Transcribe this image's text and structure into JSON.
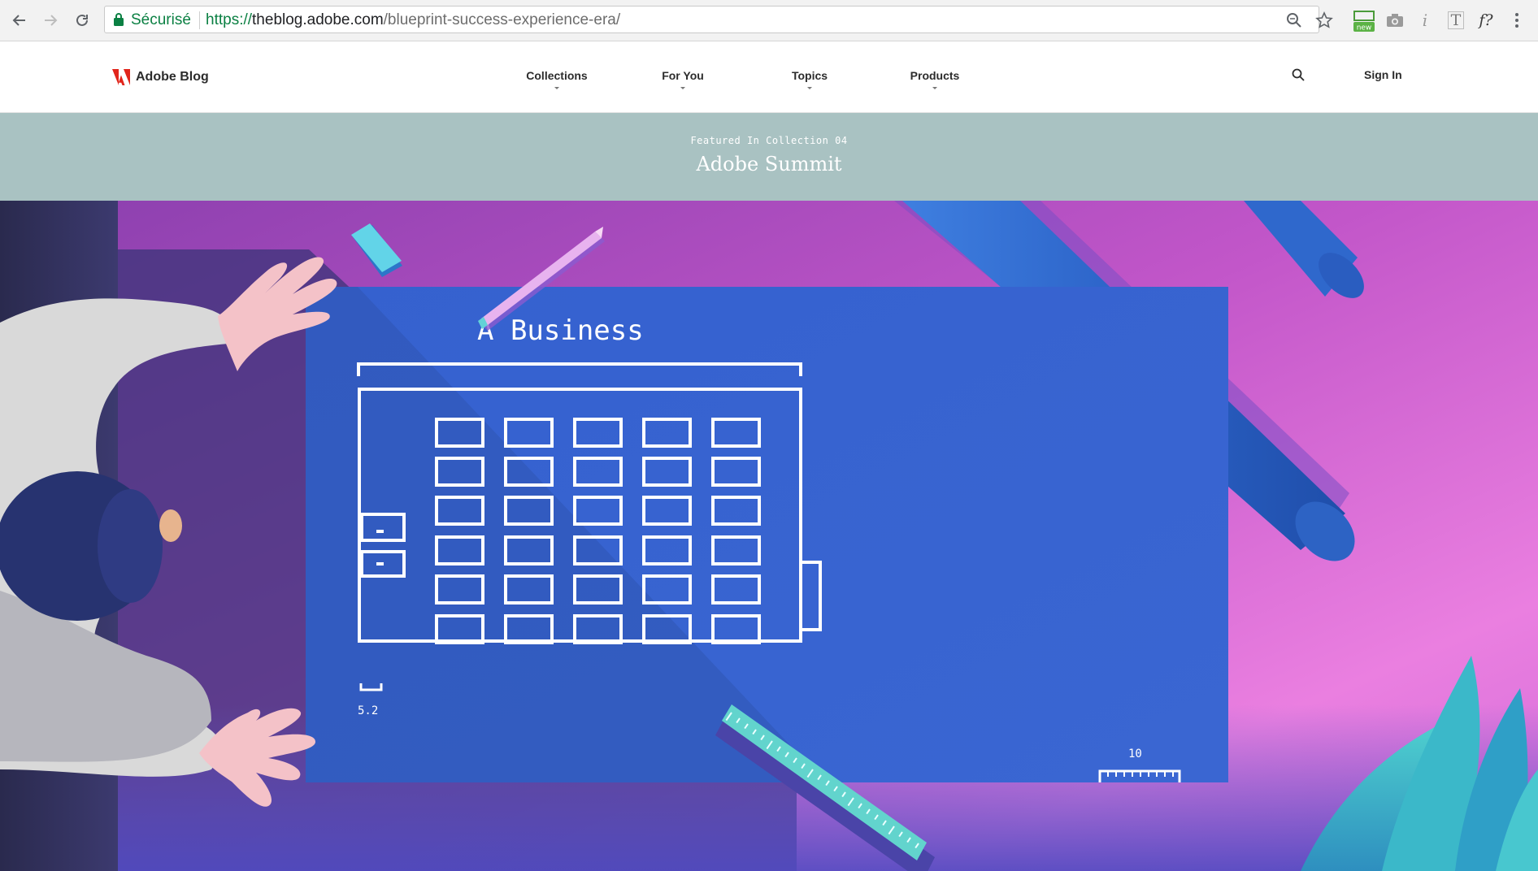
{
  "browser": {
    "security_label": "Sécurisé",
    "url_scheme": "https://",
    "url_host": "theblog.adobe.com",
    "url_path": "/blueprint-success-experience-era/",
    "ext_new_badge": "new"
  },
  "site": {
    "logo_text": "Adobe Blog",
    "nav": [
      {
        "label": "Collections"
      },
      {
        "label": "For You"
      },
      {
        "label": "Topics"
      },
      {
        "label": "Products"
      }
    ],
    "signin_label": "Sign In"
  },
  "banner": {
    "kicker": "Featured In Collection 04",
    "title": "Adobe Summit"
  },
  "hero": {
    "heading": "A Business",
    "measure_left": "5.2",
    "measure_right": "10",
    "colors": {
      "blueprint": "#3a5fcf",
      "pink": "#e57ad8",
      "magenta": "#a24ec0",
      "teal": "#5ad0cc"
    }
  }
}
